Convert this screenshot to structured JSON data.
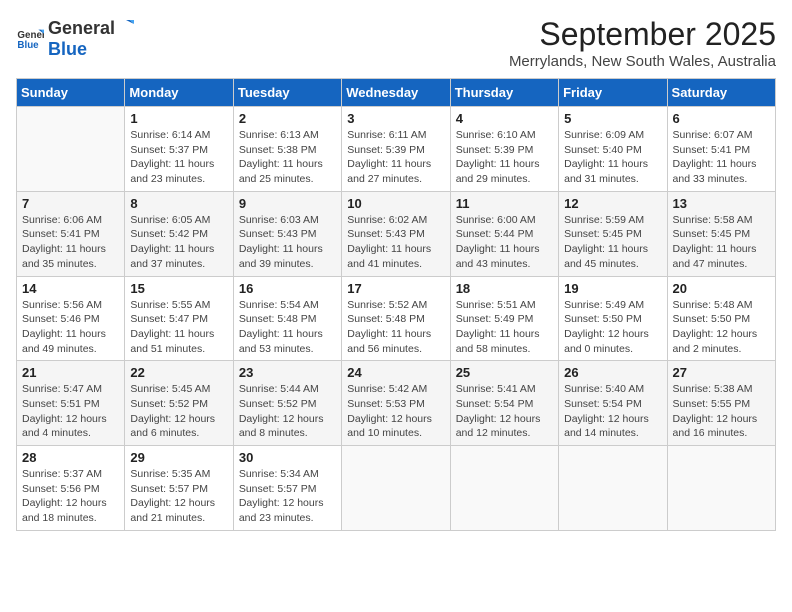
{
  "header": {
    "logo_general": "General",
    "logo_blue": "Blue",
    "month_title": "September 2025",
    "location": "Merrylands, New South Wales, Australia"
  },
  "calendar": {
    "days_of_week": [
      "Sunday",
      "Monday",
      "Tuesday",
      "Wednesday",
      "Thursday",
      "Friday",
      "Saturday"
    ],
    "weeks": [
      [
        {
          "day": "",
          "info": ""
        },
        {
          "day": "1",
          "info": "Sunrise: 6:14 AM\nSunset: 5:37 PM\nDaylight: 11 hours\nand 23 minutes."
        },
        {
          "day": "2",
          "info": "Sunrise: 6:13 AM\nSunset: 5:38 PM\nDaylight: 11 hours\nand 25 minutes."
        },
        {
          "day": "3",
          "info": "Sunrise: 6:11 AM\nSunset: 5:39 PM\nDaylight: 11 hours\nand 27 minutes."
        },
        {
          "day": "4",
          "info": "Sunrise: 6:10 AM\nSunset: 5:39 PM\nDaylight: 11 hours\nand 29 minutes."
        },
        {
          "day": "5",
          "info": "Sunrise: 6:09 AM\nSunset: 5:40 PM\nDaylight: 11 hours\nand 31 minutes."
        },
        {
          "day": "6",
          "info": "Sunrise: 6:07 AM\nSunset: 5:41 PM\nDaylight: 11 hours\nand 33 minutes."
        }
      ],
      [
        {
          "day": "7",
          "info": "Sunrise: 6:06 AM\nSunset: 5:41 PM\nDaylight: 11 hours\nand 35 minutes."
        },
        {
          "day": "8",
          "info": "Sunrise: 6:05 AM\nSunset: 5:42 PM\nDaylight: 11 hours\nand 37 minutes."
        },
        {
          "day": "9",
          "info": "Sunrise: 6:03 AM\nSunset: 5:43 PM\nDaylight: 11 hours\nand 39 minutes."
        },
        {
          "day": "10",
          "info": "Sunrise: 6:02 AM\nSunset: 5:43 PM\nDaylight: 11 hours\nand 41 minutes."
        },
        {
          "day": "11",
          "info": "Sunrise: 6:00 AM\nSunset: 5:44 PM\nDaylight: 11 hours\nand 43 minutes."
        },
        {
          "day": "12",
          "info": "Sunrise: 5:59 AM\nSunset: 5:45 PM\nDaylight: 11 hours\nand 45 minutes."
        },
        {
          "day": "13",
          "info": "Sunrise: 5:58 AM\nSunset: 5:45 PM\nDaylight: 11 hours\nand 47 minutes."
        }
      ],
      [
        {
          "day": "14",
          "info": "Sunrise: 5:56 AM\nSunset: 5:46 PM\nDaylight: 11 hours\nand 49 minutes."
        },
        {
          "day": "15",
          "info": "Sunrise: 5:55 AM\nSunset: 5:47 PM\nDaylight: 11 hours\nand 51 minutes."
        },
        {
          "day": "16",
          "info": "Sunrise: 5:54 AM\nSunset: 5:48 PM\nDaylight: 11 hours\nand 53 minutes."
        },
        {
          "day": "17",
          "info": "Sunrise: 5:52 AM\nSunset: 5:48 PM\nDaylight: 11 hours\nand 56 minutes."
        },
        {
          "day": "18",
          "info": "Sunrise: 5:51 AM\nSunset: 5:49 PM\nDaylight: 11 hours\nand 58 minutes."
        },
        {
          "day": "19",
          "info": "Sunrise: 5:49 AM\nSunset: 5:50 PM\nDaylight: 12 hours\nand 0 minutes."
        },
        {
          "day": "20",
          "info": "Sunrise: 5:48 AM\nSunset: 5:50 PM\nDaylight: 12 hours\nand 2 minutes."
        }
      ],
      [
        {
          "day": "21",
          "info": "Sunrise: 5:47 AM\nSunset: 5:51 PM\nDaylight: 12 hours\nand 4 minutes."
        },
        {
          "day": "22",
          "info": "Sunrise: 5:45 AM\nSunset: 5:52 PM\nDaylight: 12 hours\nand 6 minutes."
        },
        {
          "day": "23",
          "info": "Sunrise: 5:44 AM\nSunset: 5:52 PM\nDaylight: 12 hours\nand 8 minutes."
        },
        {
          "day": "24",
          "info": "Sunrise: 5:42 AM\nSunset: 5:53 PM\nDaylight: 12 hours\nand 10 minutes."
        },
        {
          "day": "25",
          "info": "Sunrise: 5:41 AM\nSunset: 5:54 PM\nDaylight: 12 hours\nand 12 minutes."
        },
        {
          "day": "26",
          "info": "Sunrise: 5:40 AM\nSunset: 5:54 PM\nDaylight: 12 hours\nand 14 minutes."
        },
        {
          "day": "27",
          "info": "Sunrise: 5:38 AM\nSunset: 5:55 PM\nDaylight: 12 hours\nand 16 minutes."
        }
      ],
      [
        {
          "day": "28",
          "info": "Sunrise: 5:37 AM\nSunset: 5:56 PM\nDaylight: 12 hours\nand 18 minutes."
        },
        {
          "day": "29",
          "info": "Sunrise: 5:35 AM\nSunset: 5:57 PM\nDaylight: 12 hours\nand 21 minutes."
        },
        {
          "day": "30",
          "info": "Sunrise: 5:34 AM\nSunset: 5:57 PM\nDaylight: 12 hours\nand 23 minutes."
        },
        {
          "day": "",
          "info": ""
        },
        {
          "day": "",
          "info": ""
        },
        {
          "day": "",
          "info": ""
        },
        {
          "day": "",
          "info": ""
        }
      ]
    ]
  }
}
